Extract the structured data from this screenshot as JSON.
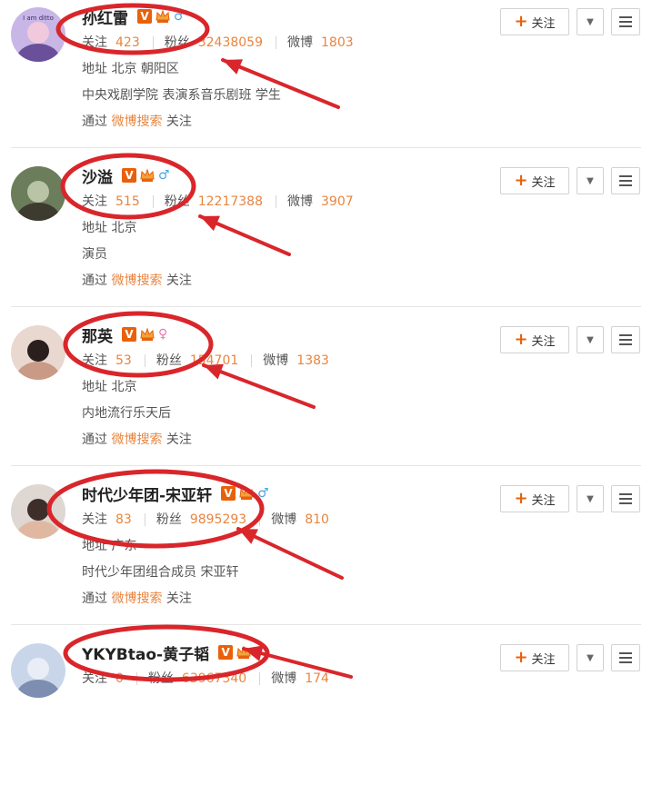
{
  "labels": {
    "follow": "关注",
    "followers": "粉丝",
    "weibo": "微博",
    "address": "地址",
    "via": "通过",
    "via_link": "微博搜索",
    "via_action": "关注",
    "follow_button": "关注"
  },
  "users": [
    {
      "name": "孙红雷",
      "gender": "♂",
      "following": "423",
      "followers": "32438059",
      "weibo": "1803",
      "address": "北京 朝阳区",
      "bio": "中央戏剧学院 表演系音乐剧班 学生",
      "show_via": true,
      "avatar_text": "I am ditto"
    },
    {
      "name": "沙溢",
      "gender": "♂",
      "following": "515",
      "followers": "12217388",
      "weibo": "3907",
      "address": "北京",
      "bio": "演员",
      "show_via": true
    },
    {
      "name": "那英",
      "gender": "♀",
      "following": "53",
      "followers": "154701",
      "weibo": "1383",
      "address": "北京",
      "bio": "内地流行乐天后",
      "show_via": true
    },
    {
      "name": "时代少年团-宋亚轩",
      "gender": "♂",
      "following": "83",
      "followers": "9895293",
      "weibo": "810",
      "address": "广东",
      "bio": "时代少年团组合成员 宋亚轩",
      "show_via": true
    },
    {
      "name": "YKYBtao-黄子韬",
      "gender": "",
      "following": "0",
      "followers": "63967340",
      "weibo": "174",
      "address": "",
      "bio": "",
      "show_via": false
    }
  ],
  "colors": {
    "accent": "#e8853f",
    "verified": "#e8610a",
    "annotation": "#d9262b",
    "male": "#4aa3df",
    "female": "#e878b5"
  },
  "icons": {
    "verified": "verified-v-icon",
    "member": "crown-member-icon",
    "dropdown": "caret-down-icon",
    "menu": "hamburger-menu-icon",
    "plus": "plus-icon"
  }
}
